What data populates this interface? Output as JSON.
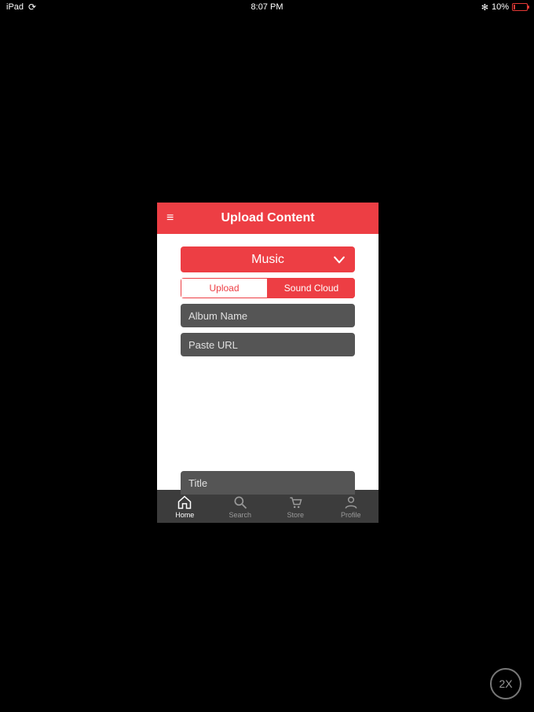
{
  "status": {
    "device": "iPad",
    "time": "8:07 PM",
    "battery_pct": "10%"
  },
  "header": {
    "title": "Upload Content"
  },
  "dropdown": {
    "selected": "Music"
  },
  "segmented": {
    "left": "Upload",
    "right": "Sound Cloud"
  },
  "fields": {
    "album_placeholder": "Album Name",
    "url_placeholder": "Paste URL",
    "title_placeholder": "Title"
  },
  "tabs": {
    "home": "Home",
    "search": "Search",
    "store": "Store",
    "profile": "Profile"
  },
  "zoom": {
    "label": "2X"
  },
  "colors": {
    "accent": "#ed3e44",
    "field_bg": "#555",
    "tabbar_bg": "#3c3c3c"
  }
}
